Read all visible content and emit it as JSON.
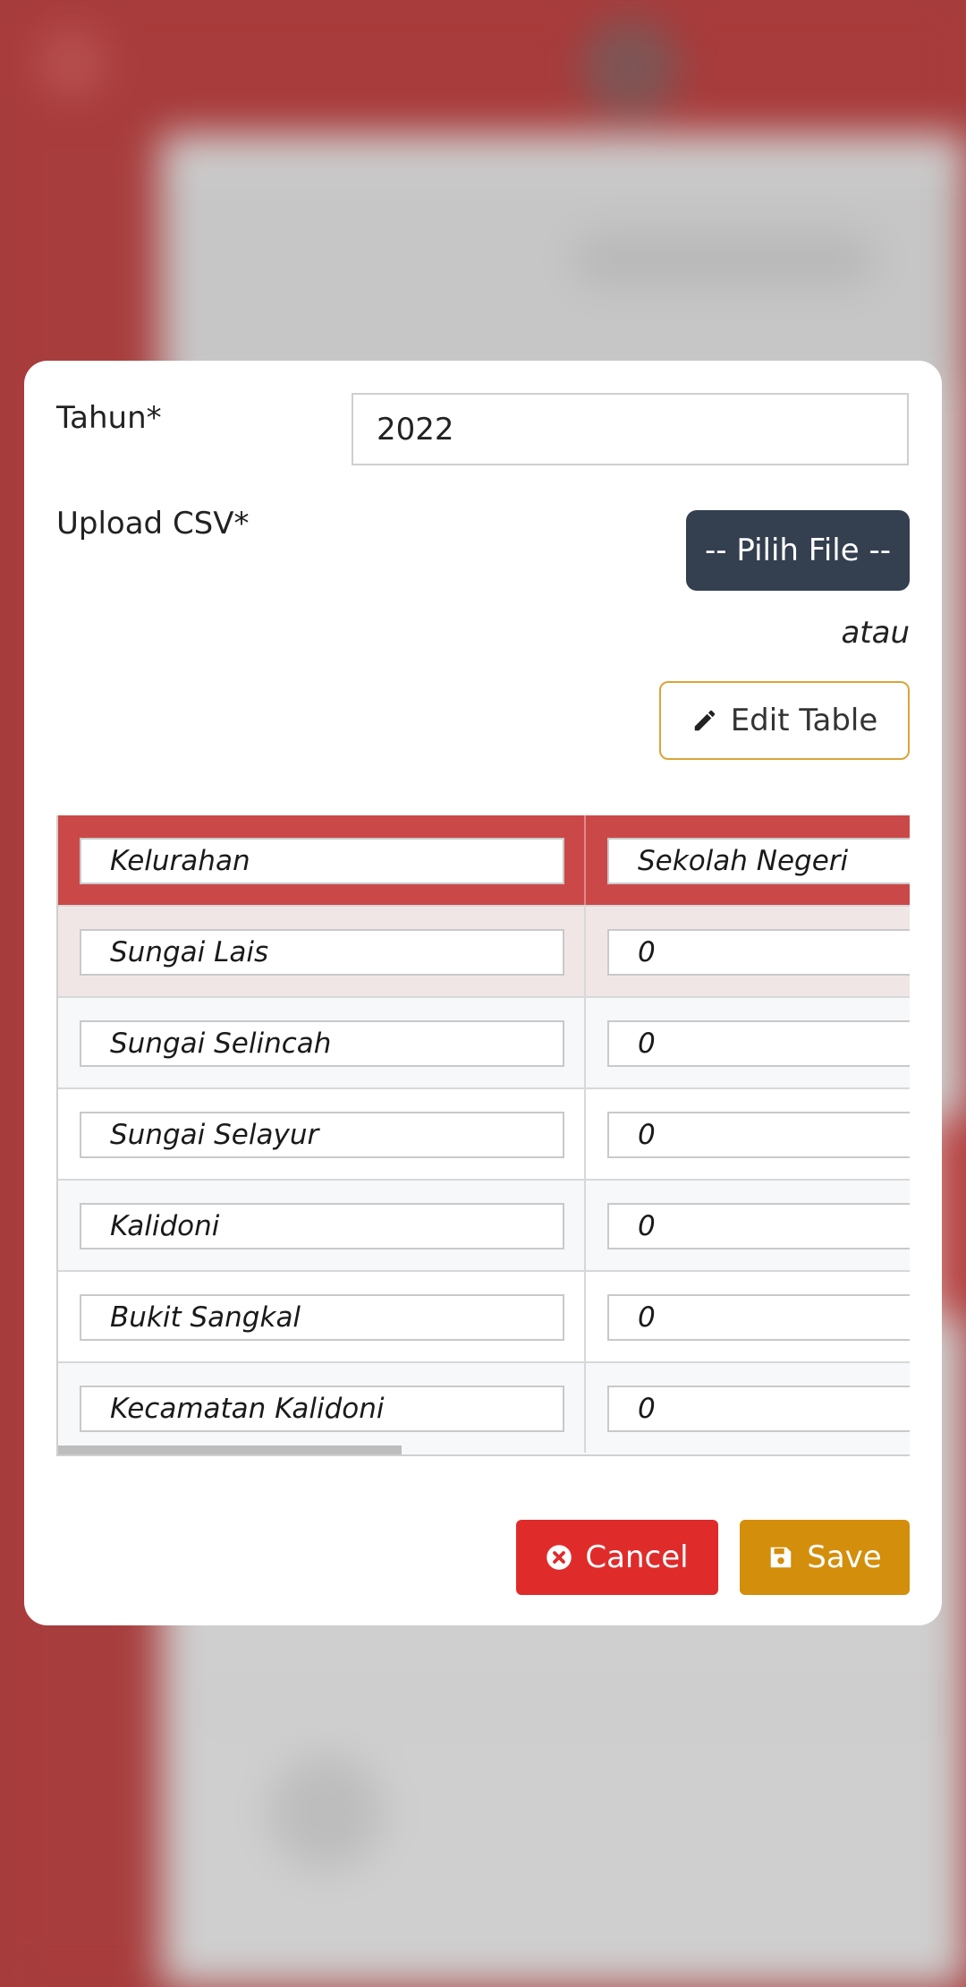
{
  "form": {
    "tahun_label": "Tahun*",
    "tahun_value": "2022",
    "upload_label": "Upload CSV*",
    "file_button": "-- Pilih File --",
    "or_text": "atau",
    "edit_table_button": "Edit Table"
  },
  "table": {
    "headers": [
      "Kelurahan",
      "Sekolah Negeri"
    ],
    "rows": [
      [
        "Sungai Lais",
        "0"
      ],
      [
        "Sungai Selincah",
        "0"
      ],
      [
        "Sungai Selayur",
        "0"
      ],
      [
        "Kalidoni",
        "0"
      ],
      [
        "Bukit Sangkal",
        "0"
      ],
      [
        "Kecamatan Kalidoni",
        "0"
      ]
    ]
  },
  "footer": {
    "cancel_label": "Cancel",
    "save_label": "Save"
  },
  "colors": {
    "header_red": "#cb4848",
    "file_button": "#343f50",
    "cancel": "#e02b2b",
    "save": "#d38e0c",
    "edit_border": "#d9a53a"
  },
  "icons": {
    "edit": "pencil-icon",
    "cancel": "times-circle-icon",
    "save": "floppy-disk-icon"
  }
}
